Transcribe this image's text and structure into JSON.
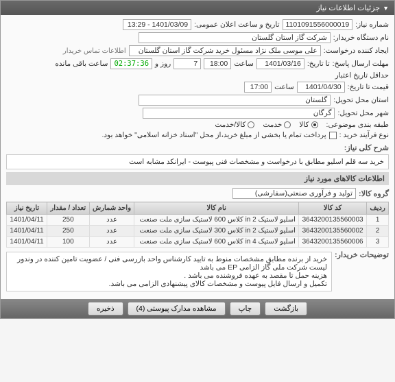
{
  "header": {
    "title": "جزئیات اطلاعات نیاز"
  },
  "fields": {
    "needNoLabel": "شماره نیاز:",
    "needNo": "1101091556000019",
    "announceLabel": "تاریخ و ساعت اعلان عمومی:",
    "announce": "1401/03/09 - 13:29",
    "buyerLabel": "نام دستگاه خریدار:",
    "buyer": "شرکت گاز استان گلستان",
    "creatorLabel": "ایجاد کننده درخواست:",
    "creator": "علی موسی ملک نژاد مسئول خرید شرکت گاز استان گلستان",
    "contactInfo": "اطلاعات تماس خریدار",
    "deadlineLabel": "مهلت ارسال پاسخ:",
    "dateToLabel": "تا تاریخ:",
    "deadlineDate": "1401/03/16",
    "timeLabel": "ساعت",
    "deadlineTime": "18:00",
    "dayLabel": "روز و",
    "dayCount": "7",
    "remainLabel": "ساعت باقی مانده",
    "remainTime": "02:37:36",
    "creditLabel": "حداقل تاریخ اعتبار",
    "priceToLabel": "قیمت تا تاریخ:",
    "creditDate": "1401/04/30",
    "creditTime": "17:00",
    "provinceLabel": "استان محل تحویل:",
    "province": "گلستان",
    "cityLabel": "شهر محل تحویل:",
    "city": "گرگان",
    "topicLabel": "طبقه بندی موضوعی:",
    "topicOpt1": "کالا",
    "topicOpt2": "خدمت",
    "topicOpt3": "کالا/خدمت",
    "buyTypeLabel": "نوع فرآیند خرید :",
    "buyTypeNote": "پرداخت تمام یا بخشی از مبلغ خرید،از محل \"اسناد خزانه اسلامی\" خواهد بود.",
    "summaryLabel": "شرح کلی نیاز:",
    "summary": "خرید سه قلم اسلیو مطابق با درخواست و مشخصات فنی پیوست - ایرانکد مشابه است",
    "itemsTitle": "اطلاعات کالاهای مورد نیاز",
    "groupLabel": "گروه کالا:",
    "group": "تولید و فرآوری صنعتی(سفارشی)",
    "explainLabel": "توضیحات خریدار:",
    "explainLine1": "خرید از برنده مطابق مشخصات منوط به تایید کارشناس واحد بازرسی فنی / عضویت تامین کننده در وندور",
    "explainLine2": "لیست شرکت ملی گاز الزامی EP می باشد",
    "explainLine3": "هزینه حمل تا مقصد به عهده فروشنده می باشد .",
    "explainLine4": "تکمیل و ارسال فایل پیوست و مشخصات کالای پیشنهادی الزامی می باشد."
  },
  "table": {
    "headers": {
      "row": "ردیف",
      "code": "کد کالا",
      "name": "نام کالا",
      "unit": "واحد شمارش",
      "qty": "تعداد / مقدار",
      "date": "تاریخ نیاز"
    },
    "rows": [
      {
        "n": "1",
        "code": "3643200135560003",
        "name": "اسلیو لاستیک in 2 کلاس 600 لاستیک سازی ملت صنعت",
        "unit": "عدد",
        "qty": "250",
        "date": "1401/04/11"
      },
      {
        "n": "2",
        "code": "3643200135560002",
        "name": "اسلیو لاستیک in 2 کلاس 300 لاستیک سازی ملت صنعت",
        "unit": "عدد",
        "qty": "250",
        "date": "1401/04/11"
      },
      {
        "n": "3",
        "code": "3643200135560006",
        "name": "اسلیو لاستیک in 4 کلاس 600 لاستیک سازی ملت صنعت",
        "unit": "عدد",
        "qty": "100",
        "date": "1401/04/11"
      }
    ]
  },
  "buttons": {
    "back": "بازگشت",
    "print": "چاپ",
    "attachments": "مشاهده مدارک پیوستی    (4)",
    "save": "ذخیره"
  }
}
